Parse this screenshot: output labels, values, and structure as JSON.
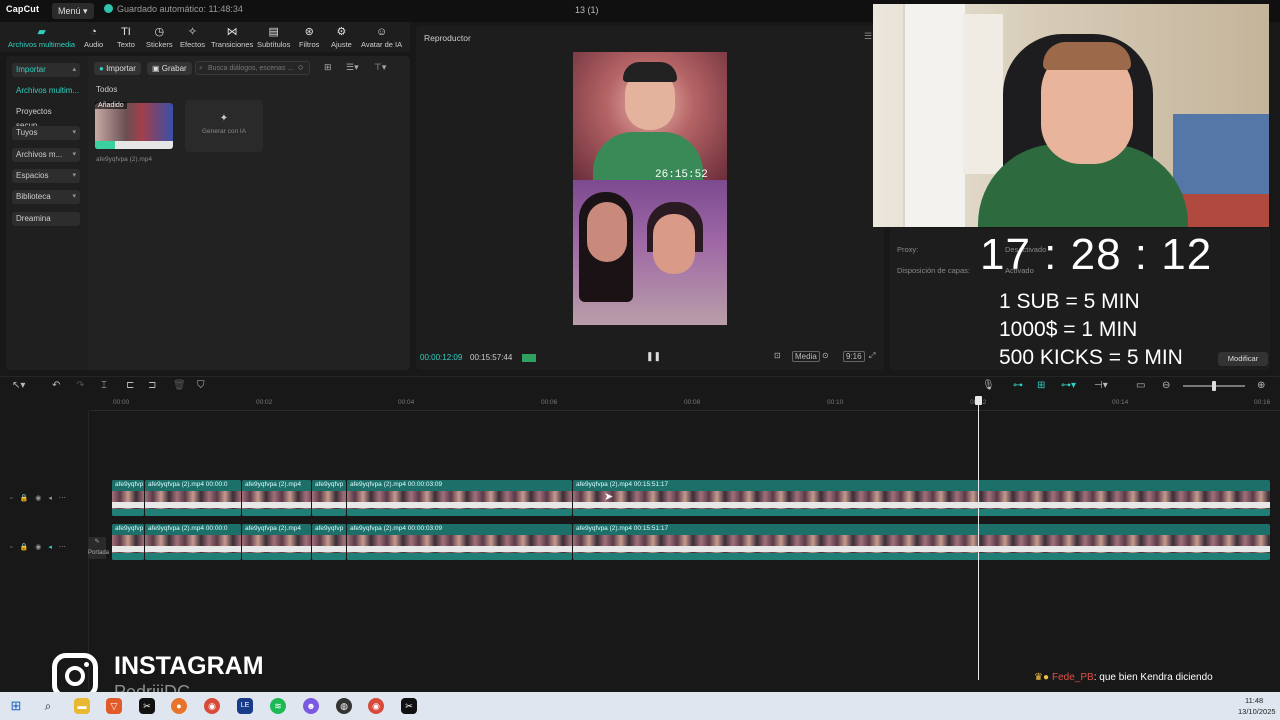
{
  "titlebar": {
    "logo": "CapCut",
    "menu": "Menú",
    "autosave": "Guardado automático: 11:48:34",
    "project_title": "13 (1)"
  },
  "toolbar": {
    "items": [
      {
        "label": "Archivos multimedia",
        "icon": "media-icon",
        "active": true
      },
      {
        "label": "Audio",
        "icon": "audio-icon"
      },
      {
        "label": "Texto",
        "icon": "text-icon"
      },
      {
        "label": "Stickers",
        "icon": "sticker-icon"
      },
      {
        "label": "Efectos",
        "icon": "effects-icon"
      },
      {
        "label": "Transiciones",
        "icon": "transitions-icon"
      },
      {
        "label": "Subtítulos",
        "icon": "subtitles-icon"
      },
      {
        "label": "Filtros",
        "icon": "filters-icon"
      },
      {
        "label": "Ajuste",
        "icon": "adjust-icon"
      },
      {
        "label": "Avatar de IA",
        "icon": "avatar-icon"
      }
    ]
  },
  "sidebar": {
    "items": [
      {
        "label": "Importar"
      },
      {
        "label": "Archivos multim..."
      },
      {
        "label": "Proyectos secun..."
      },
      {
        "label": "Tuyos"
      },
      {
        "label": "Archivos m..."
      },
      {
        "label": "Espacios"
      },
      {
        "label": "Biblioteca"
      },
      {
        "label": "Dreamina"
      }
    ]
  },
  "media": {
    "import_btn": "Importar",
    "record_btn": "Grabar",
    "search_placeholder": "Busca diálogos, escenas ...",
    "section": "Todos",
    "added_badge": "Añadido",
    "file_name": "afe9yqfvpa (2).mp4",
    "generate_label": "Generar con IA"
  },
  "player": {
    "title": "Reproductor",
    "overlay_timer": "26:15:52",
    "current_time": "00:00:12:09",
    "total_time": "00:15:57:44",
    "media_btn": "Media",
    "ratio_btn": "9:16"
  },
  "props": {
    "proxy": "Proxy:",
    "proxy_value": "Desactivado",
    "layout": "Disposición de capas:",
    "layout_value": "Activado",
    "modify": "Modificar"
  },
  "stream": {
    "timer": "17 : 28 : 12",
    "rules": [
      "1 SUB = 5 MIN",
      "1000$ = 1 MIN",
      "500 KICKS = 5 MIN"
    ],
    "ig_title": "INSTAGRAM",
    "ig_handle": "PedriiiDC",
    "chat_user": "Fede_PB",
    "chat_text": ": que bien Kendra diciendo"
  },
  "timeline": {
    "ticks": [
      "00:00",
      "00:02",
      "00:04",
      "00:06",
      "00:08",
      "00:10",
      "00:12",
      "00:14",
      "00:16"
    ],
    "cover_label": "Portada",
    "track1": [
      {
        "label": "afe9yqfvp"
      },
      {
        "label": "afe9yqfvpa (2).mp4   00:00:0"
      },
      {
        "label": "afe9yqfvpa (2).mp4"
      },
      {
        "label": "afe9yqfvp"
      },
      {
        "label": "afe9yqfvpa (2).mp4   00:00:03:09"
      },
      {
        "label": "afe9yqfvpa (2).mp4   00:15:51:17"
      }
    ],
    "track2": [
      {
        "label": "afe9yqfvp"
      },
      {
        "label": "afe9yqfvpa (2).mp4   00:00:0"
      },
      {
        "label": "afe9yqfvpa (2).mp4"
      },
      {
        "label": "afe9yqfvp"
      },
      {
        "label": "afe9yqfvpa (2).mp4   00:00:03:09"
      },
      {
        "label": "afe9yqfvpa (2).mp4   00:15:51:17"
      }
    ]
  },
  "taskbar": {
    "time": "11:48",
    "date": "13/10/2025"
  },
  "colors": {
    "accent": "#2fd0c0",
    "clip_header": "#1d6f6a"
  }
}
